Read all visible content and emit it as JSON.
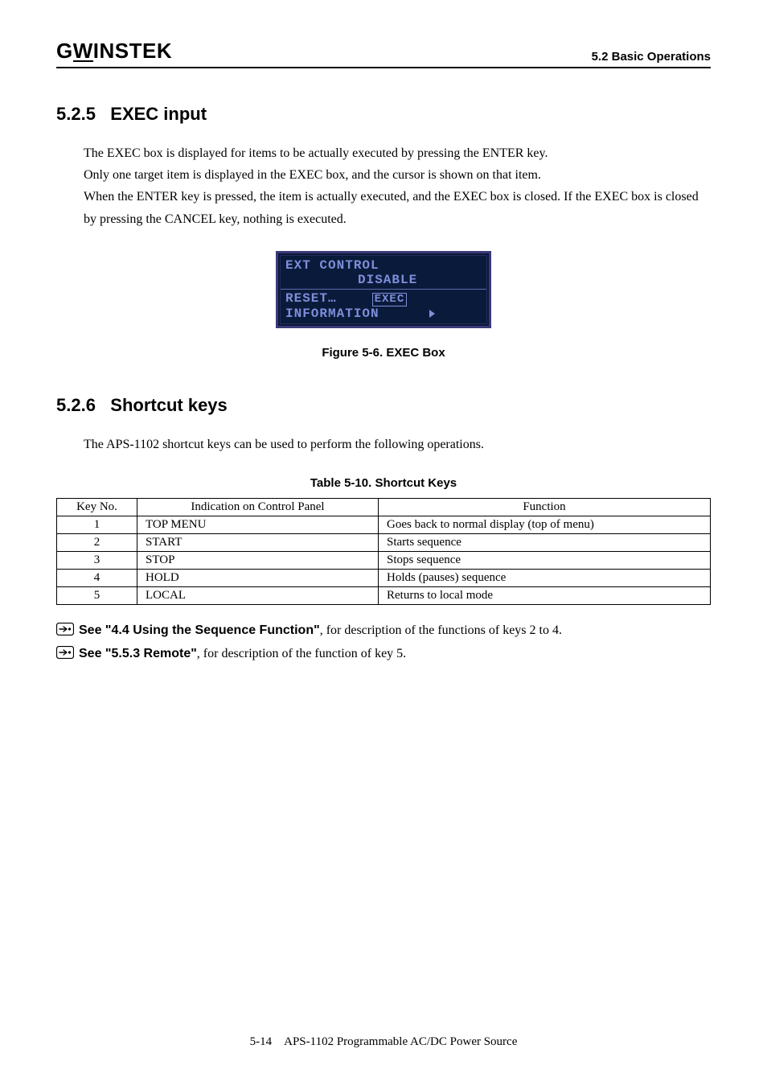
{
  "header": {
    "logo_prefix": "G",
    "logo_u": "W",
    "logo_rest": "INSTEK",
    "right": "5.2 Basic Operations"
  },
  "section1": {
    "number": "5.2.5",
    "title": "EXEC input",
    "para1": "The EXEC box is displayed for items to be actually executed by pressing the ENTER key.",
    "para2": "Only one target item is displayed in the EXEC box, and the cursor is shown on that item.",
    "para3": "When the ENTER key is pressed, the item is actually executed, and the EXEC box is closed.  If the EXEC box is closed by pressing the CANCEL key, nothing is executed."
  },
  "lcd": {
    "line1": "EXT CONTROL",
    "line1_right": "DISABLE",
    "line2_left": "RESET…",
    "line2_exec": "EXEC",
    "line3": "INFORMATION"
  },
  "fig_caption": "Figure 5-6.  EXEC Box",
  "section2": {
    "number": "5.2.6",
    "title": "Shortcut keys",
    "intro": "The APS-1102 shortcut keys can be used to perform the following operations."
  },
  "table": {
    "caption": "Table 5-10.  Shortcut Keys",
    "headers": {
      "c1": "Key No.",
      "c2": "Indication on Control Panel",
      "c3": "Function"
    },
    "rows": [
      {
        "no": "1",
        "ind": "TOP MENU",
        "fn": "Goes back to normal display (top of menu)"
      },
      {
        "no": "2",
        "ind": "START",
        "fn": "Starts sequence"
      },
      {
        "no": "3",
        "ind": "STOP",
        "fn": "Stops sequence"
      },
      {
        "no": "4",
        "ind": "HOLD",
        "fn": "Holds (pauses) sequence"
      },
      {
        "no": "5",
        "ind": "LOCAL",
        "fn": "Returns to local mode"
      }
    ]
  },
  "see": {
    "s1_bold": "See \"4.4  Using the Sequence Function\"",
    "s1_rest": ", for description of the functions of keys 2 to 4.",
    "s2_bold": "See \"5.5.3  Remote\"",
    "s2_rest": ", for description of the function of key 5."
  },
  "footer": {
    "page": "5-14",
    "doc": "APS-1102 Programmable AC/DC Power Source"
  }
}
